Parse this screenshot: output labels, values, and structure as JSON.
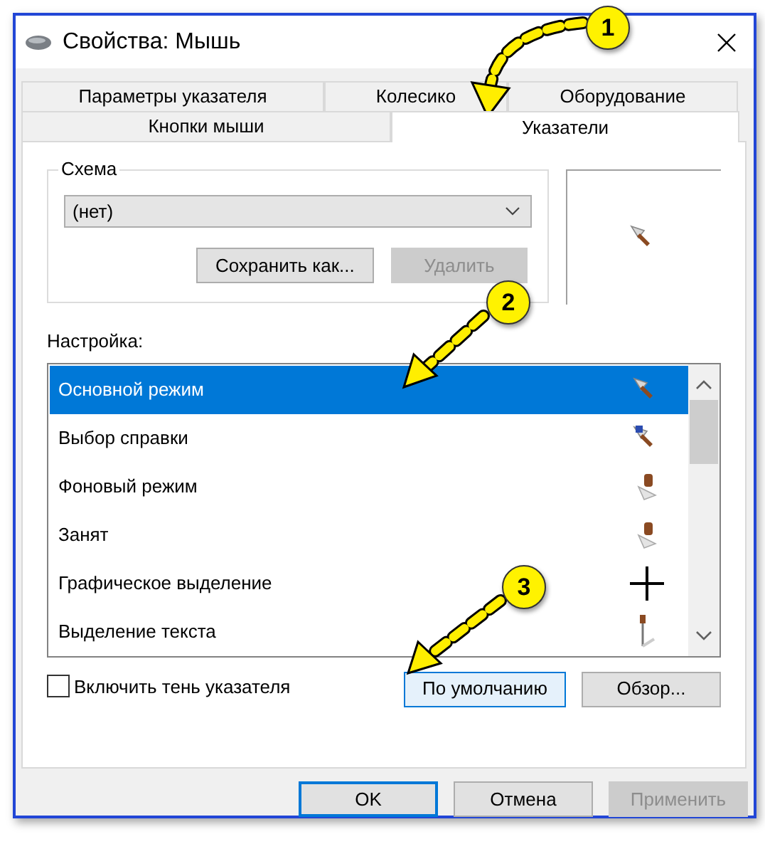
{
  "window": {
    "title": "Свойства: Мышь"
  },
  "tab_rows": [
    [
      {
        "label": "Параметры указателя",
        "selected": false
      },
      {
        "label": "Колесико",
        "selected": false
      },
      {
        "label": "Оборудование",
        "selected": false
      }
    ],
    [
      {
        "label": "Кнопки мыши",
        "selected": false
      },
      {
        "label": "Указатели",
        "selected": true
      }
    ]
  ],
  "scheme": {
    "label": "Схема",
    "value": "(нет)",
    "buttons": [
      {
        "label": "Сохранить как...",
        "disabled": false
      },
      {
        "label": "Удалить",
        "disabled": true
      }
    ]
  },
  "customize": {
    "label": "Настройка:",
    "items": [
      {
        "name": "Основной режим",
        "selected": true,
        "kind": "arrow"
      },
      {
        "name": "Выбор справки",
        "selected": false,
        "kind": "help"
      },
      {
        "name": "Фоновый режим",
        "selected": false,
        "kind": "working"
      },
      {
        "name": "Занят",
        "selected": false,
        "kind": "working"
      },
      {
        "name": "Графическое выделение",
        "selected": false,
        "kind": "cross"
      },
      {
        "name": "Выделение текста",
        "selected": false,
        "kind": "text"
      }
    ]
  },
  "shadow": {
    "label": "Включить тень указателя",
    "checked": false
  },
  "list_buttons": [
    {
      "label": "По умолчанию",
      "focused": true
    },
    {
      "label": "Обзор...",
      "focused": false
    }
  ],
  "dialog_buttons": [
    {
      "label": "OK",
      "default": true,
      "disabled": false
    },
    {
      "label": "Отмена",
      "default": false,
      "disabled": false
    },
    {
      "label": "Применить",
      "default": false,
      "disabled": true
    }
  ],
  "annotations": [
    {
      "label": "1"
    },
    {
      "label": "2"
    },
    {
      "label": "3"
    }
  ]
}
